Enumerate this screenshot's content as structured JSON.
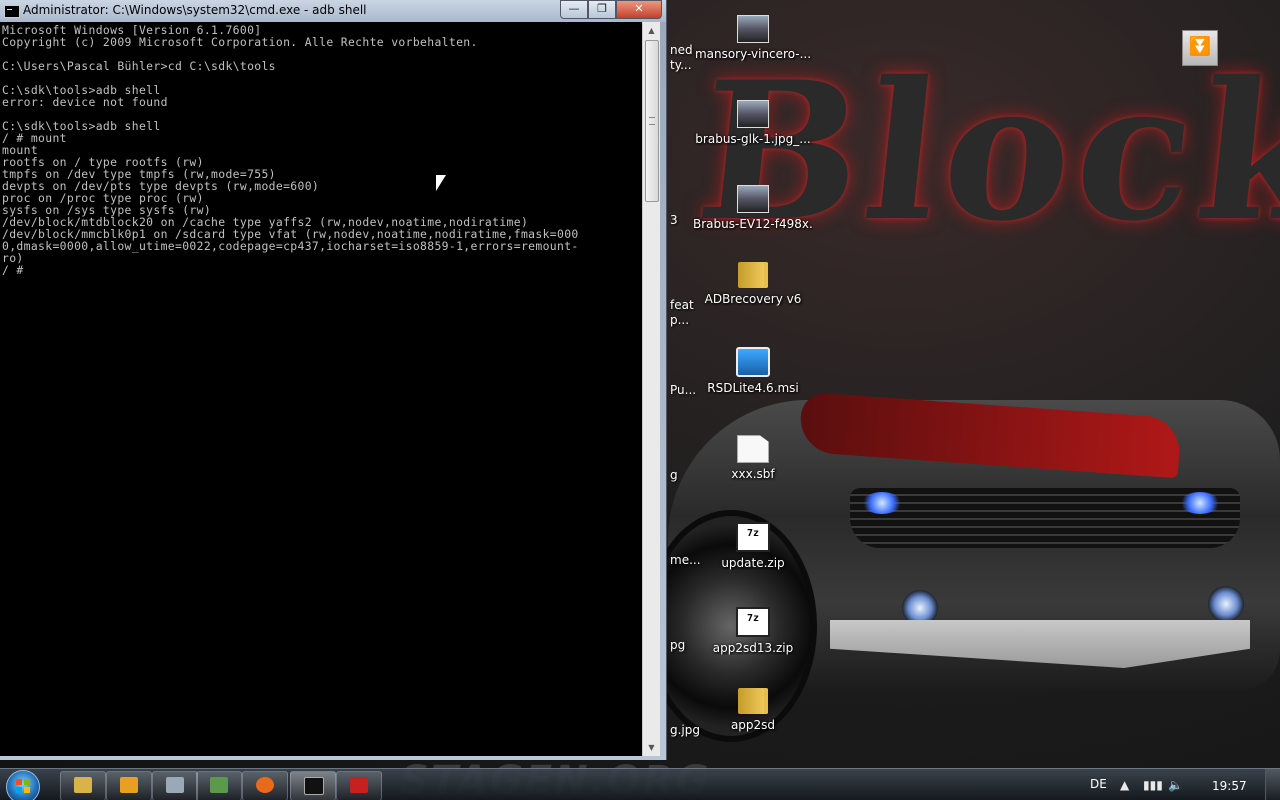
{
  "cmd_window": {
    "title": "Administrator: C:\\Windows\\system32\\cmd.exe - adb  shell",
    "controls": {
      "minimize": "—",
      "maximize": "❐",
      "close": "✕"
    },
    "console_lines": [
      "Microsoft Windows [Version 6.1.7600]",
      "Copyright (c) 2009 Microsoft Corporation. Alle Rechte vorbehalten.",
      "",
      "C:\\Users\\Pascal Bühler>cd C:\\sdk\\tools",
      "",
      "C:\\sdk\\tools>adb shell",
      "error: device not found",
      "",
      "C:\\sdk\\tools>adb shell",
      "/ # mount",
      "mount",
      "rootfs on / type rootfs (rw)",
      "tmpfs on /dev type tmpfs (rw,mode=755)",
      "devpts on /dev/pts type devpts (rw,mode=600)",
      "proc on /proc type proc (rw)",
      "sysfs on /sys type sysfs (rw)",
      "/dev/block/mtdblock20 on /cache type yaffs2 (rw,nodev,noatime,nodiratime)",
      "/dev/block/mmcblk0p1 on /sdcard type vfat (rw,nodev,noatime,nodiratime,fmask=000",
      "0,dmask=0000,allow_utime=0022,codepage=cp437,iocharset=iso8859-1,errors=remount-",
      "ro)",
      "/ #"
    ]
  },
  "desktop_icons": [
    {
      "label": "mansory-vincero-...",
      "icon": "photo-icon"
    },
    {
      "label": "brabus-glk-1.jpg_...",
      "icon": "photo-icon"
    },
    {
      "label": "Brabus-EV12-f498x...",
      "icon": "photo-icon"
    },
    {
      "label": "ADBrecovery v6",
      "icon": "folder-icon"
    },
    {
      "label": "RSDLite4.6.msi",
      "icon": "installer-icon"
    },
    {
      "label": "xxx.sbf",
      "icon": "file-icon"
    },
    {
      "label": "update.zip",
      "icon": "7zip-icon"
    },
    {
      "label": "app2sd13.zip",
      "icon": "7zip-icon"
    },
    {
      "label": "app2sd",
      "icon": "folder-icon"
    }
  ],
  "partial_labels": [
    "ned",
    "ty...",
    "3",
    "feat",
    "p...",
    "Pu...",
    "g",
    "me...",
    "pg",
    "g.jpg"
  ],
  "icon_badge_text": "7z",
  "wallpaper": {
    "logo_text": "Block",
    "bottom_text": "STAGEN.ORG"
  },
  "taskbar": {
    "language": "DE",
    "clock": "19:57",
    "buttons": [
      {
        "name": "explorer",
        "color": "#d9b24a"
      },
      {
        "name": "media-player",
        "color": "#e8a020"
      },
      {
        "name": "app-grid",
        "color": "#9aa8b8"
      },
      {
        "name": "photo-viewer",
        "color": "#5a9a4a"
      },
      {
        "name": "firefox",
        "color": "#e86a1a"
      },
      {
        "name": "cmd",
        "color": "#111111"
      },
      {
        "name": "recovery-tool",
        "color": "#c82020"
      }
    ]
  },
  "colors": {
    "console_text": "#c0c0c0",
    "console_bg": "#000000",
    "stripe_red": "#b01818"
  }
}
